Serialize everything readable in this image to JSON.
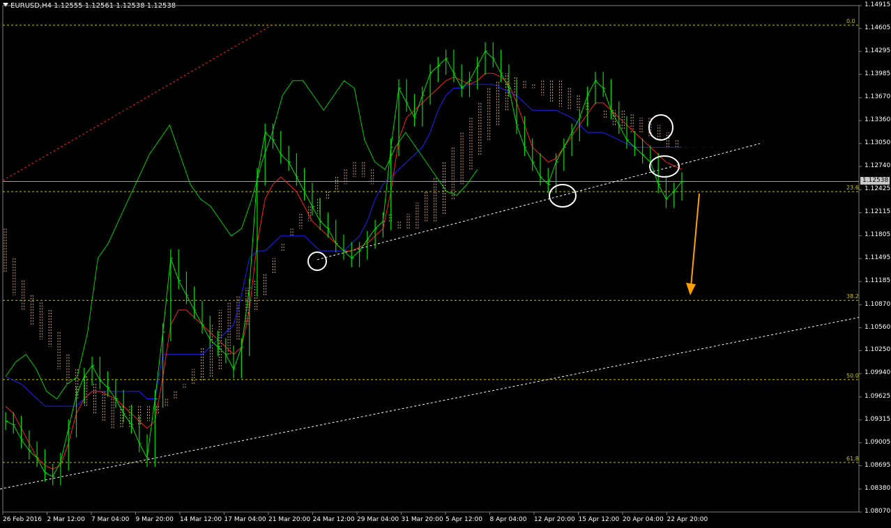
{
  "header": {
    "text": "EURUSD,H4  1.12555 1.12561 1.12538 1.12538"
  },
  "colors": {
    "background": "#000000",
    "price": "#00e000",
    "tenkan": "#ff2020",
    "kijun": "#2020ff",
    "chikou": "#00d000",
    "cloud": "#ffc89c",
    "fib": "#c8c800",
    "trend": "#ffffff",
    "arrow": "#ffa000",
    "channel_top": "#ff2020"
  },
  "current_price": "1.12538",
  "chart_data": {
    "type": "line",
    "ylim": [
      1.0807,
      1.14915
    ],
    "y_ticks": [
      "1.14915",
      "1.14605",
      "1.14295",
      "1.13985",
      "1.13670",
      "1.13360",
      "1.13050",
      "1.12740",
      "1.12425",
      "1.12115",
      "1.11805",
      "1.11495",
      "1.11185",
      "1.10870",
      "1.10560",
      "1.10250",
      "1.09940",
      "1.09625",
      "1.09315",
      "1.09005",
      "1.08695",
      "1.08380",
      "1.08070"
    ],
    "x_ticks": [
      "26 Feb 2016",
      "2 Mar 12:00",
      "7 Mar 04:00",
      "9 Mar 20:00",
      "14 Mar 12:00",
      "17 Mar 04:00",
      "21 Mar 20:00",
      "24 Mar 12:00",
      "29 Mar 04:00",
      "31 Mar 20:00",
      "5 Apr 12:00",
      "8 Apr 04:00",
      "12 Apr 20:00",
      "15 Apr 12:00",
      "20 Apr 04:00",
      "22 Apr 20:00"
    ],
    "fib_levels": [
      {
        "label": "0.0",
        "value": 1.1465
      },
      {
        "label": "23.6",
        "value": 1.124
      },
      {
        "label": "38.2",
        "value": 1.1093
      },
      {
        "label": "50.0",
        "value": 1.0986
      },
      {
        "label": "61.8",
        "value": 1.0874
      }
    ],
    "price": [
      1.093,
      1.0925,
      1.0905,
      1.089,
      1.088,
      1.086,
      1.0855,
      1.0875,
      1.092,
      1.0965,
      1.099,
      1.1005,
      1.0985,
      1.0975,
      1.096,
      1.094,
      1.0925,
      1.09,
      1.088,
      1.096,
      1.105,
      1.115,
      1.112,
      1.11,
      1.108,
      1.106,
      1.104,
      1.103,
      1.102,
      1.1,
      1.103,
      1.111,
      1.126,
      1.132,
      1.131,
      1.129,
      1.128,
      1.126,
      1.124,
      1.122,
      1.12,
      1.119,
      1.117,
      1.116,
      1.115,
      1.116,
      1.1175,
      1.119,
      1.12,
      1.13,
      1.138,
      1.136,
      1.134,
      1.137,
      1.14,
      1.141,
      1.142,
      1.14,
      1.138,
      1.139,
      1.141,
      1.143,
      1.142,
      1.14,
      1.138,
      1.133,
      1.13,
      1.128,
      1.126,
      1.125,
      1.128,
      1.13,
      1.132,
      1.134,
      1.137,
      1.139,
      1.138,
      1.135,
      1.133,
      1.131,
      1.13,
      1.129,
      1.128,
      1.125,
      1.123,
      1.124,
      1.1254
    ],
    "tenkan": [
      1.095,
      1.094,
      1.092,
      1.09,
      1.088,
      1.087,
      1.0865,
      1.087,
      1.09,
      1.094,
      1.096,
      1.097,
      1.097,
      1.0965,
      1.096,
      1.095,
      1.094,
      1.093,
      1.092,
      1.093,
      1.099,
      1.106,
      1.108,
      1.108,
      1.107,
      1.106,
      1.105,
      1.104,
      1.103,
      1.102,
      1.103,
      1.108,
      1.117,
      1.123,
      1.125,
      1.126,
      1.125,
      1.124,
      1.122,
      1.12,
      1.119,
      1.118,
      1.117,
      1.116,
      1.116,
      1.1165,
      1.117,
      1.118,
      1.119,
      1.124,
      1.131,
      1.134,
      1.135,
      1.136,
      1.137,
      1.138,
      1.139,
      1.1395,
      1.139,
      1.1385,
      1.139,
      1.14,
      1.14,
      1.1395,
      1.1385,
      1.136,
      1.133,
      1.13,
      1.129,
      1.128,
      1.1285,
      1.13,
      1.1315,
      1.133,
      1.1345,
      1.136,
      1.136,
      1.135,
      1.134,
      1.133,
      1.132,
      1.131,
      1.13,
      1.129,
      1.128,
      1.1275,
      1.127
    ],
    "kijun": [
      1.099,
      1.0985,
      1.098,
      1.097,
      1.096,
      1.095,
      1.095,
      1.095,
      1.095,
      1.095,
      1.096,
      1.097,
      1.097,
      1.097,
      1.097,
      1.097,
      1.097,
      1.097,
      1.096,
      1.096,
      1.102,
      1.102,
      1.102,
      1.102,
      1.102,
      1.102,
      1.103,
      1.104,
      1.105,
      1.106,
      1.11,
      1.115,
      1.116,
      1.116,
      1.117,
      1.118,
      1.118,
      1.118,
      1.118,
      1.117,
      1.116,
      1.116,
      1.116,
      1.116,
      1.117,
      1.118,
      1.12,
      1.123,
      1.125,
      1.126,
      1.127,
      1.128,
      1.129,
      1.13,
      1.132,
      1.135,
      1.137,
      1.138,
      1.138,
      1.1385,
      1.1385,
      1.1385,
      1.1385,
      1.138,
      1.1375,
      1.137,
      1.136,
      1.135,
      1.135,
      1.135,
      1.135,
      1.1345,
      1.134,
      1.133,
      1.132,
      1.132,
      1.132,
      1.1315,
      1.131,
      1.1305,
      1.13,
      1.13,
      1.13,
      1.13,
      1.13,
      1.13,
      1.13
    ],
    "chikou": [
      1.099,
      1.101,
      1.102,
      1.1,
      1.097,
      1.096,
      1.098,
      1.099,
      1.105,
      1.115,
      1.117,
      1.12,
      1.123,
      1.126,
      1.129,
      1.131,
      1.133,
      1.129,
      1.125,
      1.123,
      1.122,
      1.12,
      1.118,
      1.119,
      1.123,
      1.128,
      1.132,
      1.137,
      1.139,
      1.139,
      1.137,
      1.135,
      1.137,
      1.139,
      1.138,
      1.131,
      1.128,
      1.127,
      1.13,
      1.132,
      1.13,
      1.128,
      1.126,
      1.124,
      1.1235,
      1.125,
      1.127
    ],
    "cloud_a": [
      1.119,
      1.115,
      1.112,
      1.11,
      1.109,
      1.108,
      1.105,
      1.102,
      1.1,
      1.099,
      1.098,
      1.097,
      1.096,
      1.095,
      1.095,
      1.095,
      1.095,
      1.095,
      1.096,
      1.097,
      1.0975,
      1.098,
      1.0985,
      1.099,
      1.1,
      1.102,
      1.104,
      1.106,
      1.108,
      1.11,
      1.113,
      1.116,
      1.119,
      1.121,
      1.122,
      1.123,
      1.124,
      1.126,
      1.127,
      1.128,
      1.128,
      1.127,
      1.123,
      1.12,
      1.119,
      1.119,
      1.119,
      1.12,
      1.12,
      1.121,
      1.123,
      1.125,
      1.127,
      1.129,
      1.131,
      1.133,
      1.135,
      1.137,
      1.138,
      1.1385,
      1.139,
      1.139,
      1.139,
      1.138,
      1.137,
      1.136,
      1.135,
      1.134,
      1.133,
      1.1325,
      1.132,
      1.132,
      1.1315,
      1.131,
      1.13,
      1.13,
      1.13,
      1.13,
      1.13,
      1.13,
      1.13,
      1.13,
      1.13,
      1.13,
      1.13
    ],
    "cloud_b": [
      1.113,
      1.11,
      1.108,
      1.106,
      1.104,
      1.103,
      1.1,
      1.098,
      1.096,
      1.095,
      1.094,
      1.093,
      1.092,
      1.092,
      1.092,
      1.0925,
      1.093,
      1.094,
      1.095,
      1.096,
      1.098,
      1.1,
      1.103,
      1.106,
      1.108,
      1.109,
      1.11,
      1.111,
      1.112,
      1.113,
      1.115,
      1.117,
      1.118,
      1.119,
      1.12,
      1.121,
      1.123,
      1.124,
      1.125,
      1.126,
      1.126,
      1.125,
      1.123,
      1.121,
      1.12,
      1.121,
      1.1225,
      1.124,
      1.126,
      1.128,
      1.13,
      1.132,
      1.134,
      1.136,
      1.138,
      1.139,
      1.14,
      1.1395,
      1.139,
      1.138,
      1.137,
      1.136,
      1.1355,
      1.135,
      1.135,
      1.135,
      1.135,
      1.135,
      1.135,
      1.135,
      1.1345,
      1.134,
      1.134,
      1.133,
      1.132,
      1.131,
      1.13,
      1.13,
      1.13,
      1.13,
      1.13,
      1.13,
      1.13,
      1.13,
      1.13
    ]
  }
}
